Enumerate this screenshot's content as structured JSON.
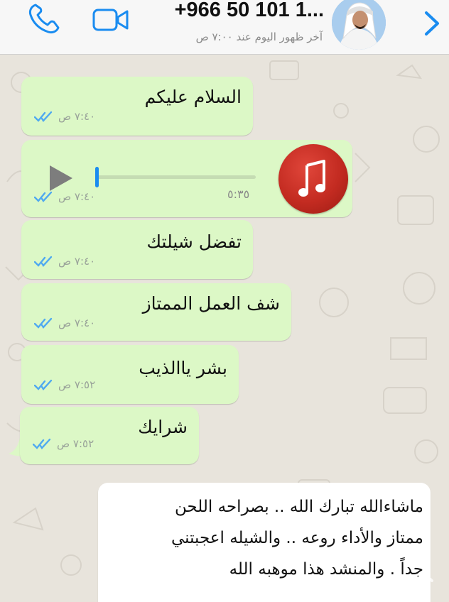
{
  "header": {
    "contact_name": "+966 50 101 1...",
    "last_seen": "آخر ظهور اليوم عند ٧:٠٠ ص"
  },
  "icons": {
    "phone": "phone-icon",
    "video": "video-camera-icon",
    "back": "chevron-right-icon",
    "read_receipt": "double-check-icon",
    "play": "play-icon",
    "music": "music-note-icon"
  },
  "colors": {
    "accent": "#1a8cf0",
    "outgoing_bubble": "#dcf8c6",
    "incoming_bubble": "#ffffff",
    "chat_background": "#e8e4dc"
  },
  "messages": [
    {
      "text": "السلام عليكم",
      "time": "٧:٤٠ ص"
    },
    {
      "audio_duration": "٥:٣٥",
      "time": "٧:٤٠ ص"
    },
    {
      "text": "تفضل شيلتك",
      "time": "٧:٤٠ ص"
    },
    {
      "text": "شف العمل الممتاز",
      "time": "٧:٤٠ ص"
    },
    {
      "text": "بشر ياالذيب",
      "time": "٧:٥٢ ص"
    },
    {
      "text": "شرايك",
      "time": "٧:٥٢ ص"
    }
  ],
  "incoming": {
    "lines": [
      "ماشاءالله تبارك الله .. بصراحه اللحن",
      "ممتاز والأداء روعه .. والشيله اعجبتني",
      "جداً . والمنشد هذا موهبه الله"
    ]
  }
}
